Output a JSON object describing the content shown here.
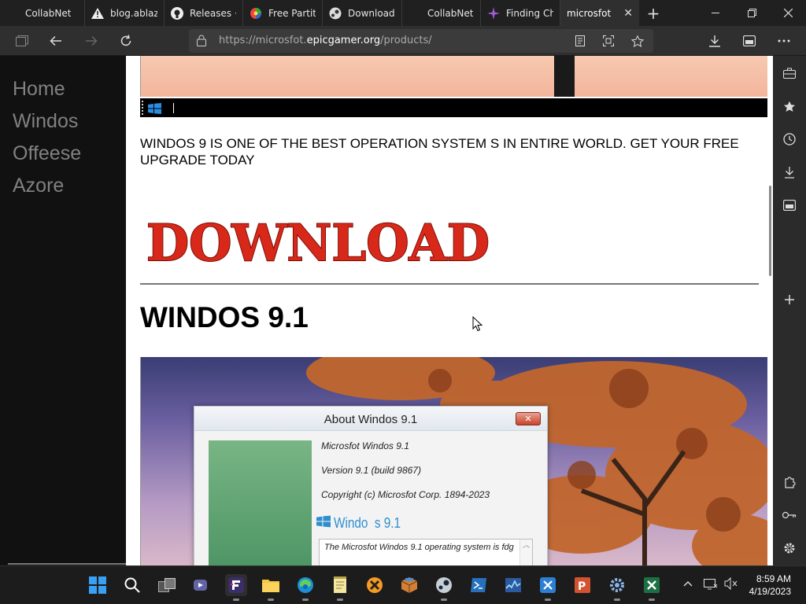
{
  "browser": {
    "tabs": [
      {
        "label": "CollabNet",
        "icon": "blank-icon"
      },
      {
        "label": "blog.ablaze.",
        "icon": "warning-icon"
      },
      {
        "label": "Releases · p",
        "icon": "github-icon"
      },
      {
        "label": "Free Partitio",
        "icon": "colorwheel-icon"
      },
      {
        "label": "Download F",
        "icon": "steam-icon"
      },
      {
        "label": "CollabNet",
        "icon": "blank-icon"
      },
      {
        "label": "Finding Cha",
        "icon": "sparkle-icon"
      },
      {
        "label": "microsfot",
        "icon": "blank-icon",
        "active": true
      }
    ],
    "url_prefix": "https://microsfot.",
    "url_domain": "epicgamer.org",
    "url_path": "/products/"
  },
  "sidebar": {
    "items": [
      {
        "label": "Home"
      },
      {
        "label": "Windos"
      },
      {
        "label": "Offeese"
      },
      {
        "label": "Azore"
      }
    ]
  },
  "main": {
    "promo_text": "WINDOS 9 IS ONE OF THE BEST OPERATION SYSTEM S IN ENTIRE WORLD. GET YOUR FREE UPGRADE TODAY",
    "download_label": "DOWNLOAD",
    "heading": "WINDOS 9.1"
  },
  "dialog": {
    "title": "About Windos 9.1",
    "product": "Microsfot Windos 9.1",
    "version": "Version 9.1 (build 9867)",
    "copyright": "Copyright (c) Microsfot Corp. 1894-2023",
    "brand_word": "Windo",
    "brand_num": "s 9.1",
    "description": "The Microsfot Windos 9.1 operating system is fdg"
  },
  "taskbar": {
    "time": "8:59 AM",
    "date": "4/19/2023"
  },
  "colors": {
    "accent": "#2f8ecf",
    "sidebar_bg": "#111111",
    "download_red": "#d8281a"
  }
}
